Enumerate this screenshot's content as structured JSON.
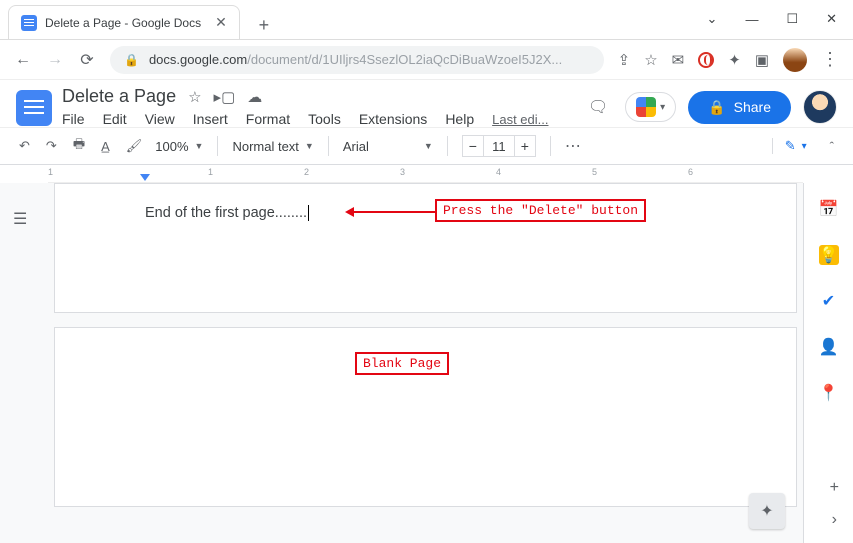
{
  "browser": {
    "tab_title": "Delete a Page - Google Docs",
    "url_host": "docs.google.com",
    "url_path": "/document/d/1UIljrs4SsezlOL2iaQcDiBuaWzoeI5J2X...",
    "win": {
      "down": "⌄",
      "min": "—",
      "max": "☐",
      "close": "✕"
    }
  },
  "docs": {
    "title": "Delete a Page",
    "menus": {
      "file": "File",
      "edit": "Edit",
      "view": "View",
      "insert": "Insert",
      "format": "Format",
      "tools": "Tools",
      "extensions": "Extensions",
      "help": "Help"
    },
    "last_edit": "Last edi...",
    "share": "Share"
  },
  "toolbar": {
    "zoom": "100%",
    "style": "Normal text",
    "font": "Arial",
    "size": "11",
    "more": "⋯"
  },
  "ruler": {
    "n1": "1",
    "p1": "1",
    "p2": "2",
    "p3": "3",
    "p4": "4",
    "p5": "5",
    "p6": "6"
  },
  "document": {
    "page1_text": "End of the first page........"
  },
  "annotations": {
    "delete_hint": "Press the \"Delete\" button",
    "blank_label": "Blank Page"
  }
}
